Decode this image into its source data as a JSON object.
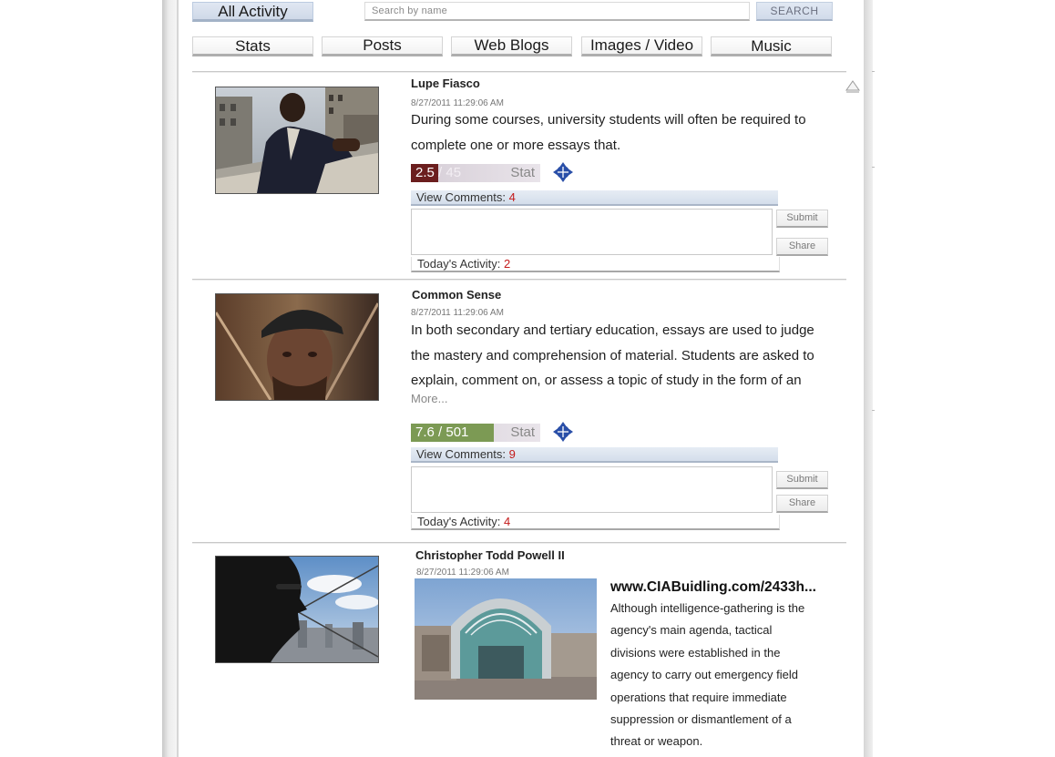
{
  "nav": {
    "all_activity": "All Activity",
    "search_placeholder": "Search by name",
    "search_button": "SEARCH",
    "tabs": [
      "Stats",
      "Posts",
      "Web Blogs",
      "Images / Video",
      "Music"
    ]
  },
  "posts": [
    {
      "name": "Lupe Fiasco",
      "date": "8/27/2011 11:29:06 AM",
      "text_lines": [
        "During some courses, university students will often be required to",
        "complete one or more essays that."
      ],
      "score": "2.5",
      "score_total": "/ 45",
      "score_fraction": 0.055,
      "stat_label": "Stat",
      "view_comments_label": "View Comments:",
      "comments_count": "4",
      "activity_label": "Today's Activity:",
      "activity_count": "2",
      "submit": "Submit",
      "share": "Share",
      "colors": {
        "score_fill": "#6b1e1e",
        "bar_rest": "#d5cdd6"
      }
    },
    {
      "name": "Common Sense",
      "date": "8/27/2011 11:29:06 AM",
      "text_lines": [
        "In both secondary and tertiary education, essays are used to judge",
        "the mastery and comprehension of material. Students are asked to",
        "explain, comment on, or assess a topic of study in the form of an"
      ],
      "more": "More...",
      "score": "7.6 / 501",
      "score_fraction": 0.015,
      "stat_label": "Stat",
      "view_comments_label": "View Comments:",
      "comments_count": "9",
      "activity_label": "Today's Activity:",
      "activity_count": "4",
      "submit": "Submit",
      "share": "Share",
      "colors": {
        "score_fill": "#7c9a54",
        "bar_rest": "#d8d2da"
      }
    },
    {
      "name": "Christopher Todd Powell II",
      "date": "8/27/2011 11:29:06 AM",
      "link_title": "www.CIABuidling.com/2433h...",
      "article_lines": [
        "Although intelligence-gathering is the",
        "agency's main agenda, tactical",
        "divisions were established in the",
        "agency to carry out emergency field",
        "operations that require immediate",
        "suppression or dismantlement of a",
        "threat or weapon."
      ]
    }
  ]
}
